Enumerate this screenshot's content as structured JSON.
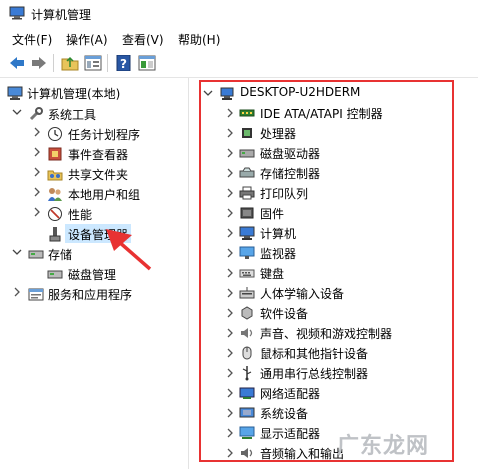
{
  "window": {
    "title": "计算机管理"
  },
  "menu": [
    "文件(F)",
    "操作(A)",
    "查看(V)",
    "帮助(H)"
  ],
  "toolbar": [
    "back-arrow-icon",
    "forward-arrow-icon",
    "up-folder-icon",
    "properties-icon",
    "help-icon",
    "show-hide-icon"
  ],
  "tree": {
    "root": "计算机管理(本地)",
    "sections": [
      {
        "label": "系统工具",
        "expanded": true,
        "items": [
          "任务计划程序",
          "事件查看器",
          "共享文件夹",
          "本地用户和组",
          "性能",
          "设备管理器"
        ]
      },
      {
        "label": "存储",
        "expanded": true,
        "items": [
          "磁盘管理"
        ]
      },
      {
        "label": "服务和应用程序",
        "expanded": false,
        "items": []
      }
    ],
    "selected": "设备管理器"
  },
  "devices": {
    "computer": "DESKTOP-U2HDERM",
    "categories": [
      "IDE ATA/ATAPI 控制器",
      "处理器",
      "磁盘驱动器",
      "存储控制器",
      "打印队列",
      "固件",
      "计算机",
      "监视器",
      "键盘",
      "人体学输入设备",
      "软件设备",
      "声音、视频和游戏控制器",
      "鼠标和其他指针设备",
      "通用串行总线控制器",
      "网络适配器",
      "系统设备",
      "显示适配器",
      "音频输入和输出"
    ]
  },
  "watermark": "广东龙网",
  "colors": {
    "highlight": "#e83232",
    "selection": "#cce8ff"
  }
}
